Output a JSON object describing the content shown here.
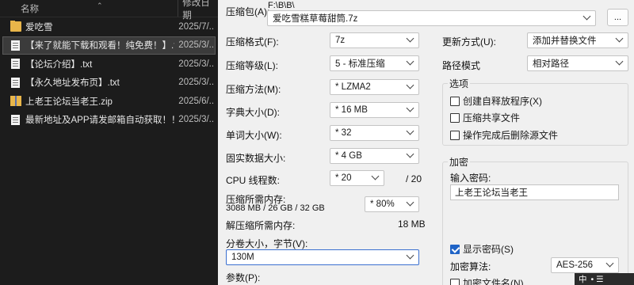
{
  "explorer": {
    "col_name": "名称",
    "col_date": "修改日期",
    "files": [
      {
        "name": "爱吃雪",
        "date": "2025/7/...",
        "type": "folder",
        "selected": false
      },
      {
        "name": "【来了就能下载和观看！纯免费！】.txt",
        "date": "2025/3/...",
        "type": "txt",
        "selected": true
      },
      {
        "name": "【论坛介绍】.txt",
        "date": "2025/3/...",
        "type": "txt",
        "selected": false
      },
      {
        "name": "【永久地址发布页】.txt",
        "date": "2025/3/...",
        "type": "txt",
        "selected": false
      },
      {
        "name": "上老王论坛当老王.zip",
        "date": "2025/6/...",
        "type": "zip",
        "selected": false
      },
      {
        "name": "最新地址及APP请发邮箱自动获取！！！...",
        "date": "2025/3/...",
        "type": "txt",
        "selected": false
      }
    ]
  },
  "dialog": {
    "archive_label": "压缩包(A):",
    "archive_path": "F:\\B\\B\\",
    "archive_name": "爱吃雪糕草莓甜筒.7z",
    "browse_label": "...",
    "format_label": "压缩格式(F):",
    "format_value": "7z",
    "level_label": "压缩等级(L):",
    "level_value": "5 - 标准压缩",
    "method_label": "压缩方法(M):",
    "method_value": "* LZMA2",
    "dict_label": "字典大小(D):",
    "dict_value": "* 16 MB",
    "word_label": "单词大小(W):",
    "word_value": "* 32",
    "solid_label": "固实数据大小:",
    "solid_value": "* 4 GB",
    "threads_label": "CPU 线程数:",
    "threads_value": "* 20",
    "threads_max": "/ 20",
    "mem_comp_label": "压缩所需内存:",
    "mem_comp_value": "3088 MB / 26 GB / 32 GB",
    "mem_percent": "* 80%",
    "mem_decomp_label": "解压缩所需内存:",
    "mem_decomp_value": "18 MB",
    "volume_label": "分卷大小，字节(V):",
    "volume_value": "130M",
    "params_label": "参数(P):",
    "update_label": "更新方式(U):",
    "update_value": "添加并替换文件",
    "path_label": "路径模式",
    "path_value": "相对路径",
    "options_title": "选项",
    "opt_sfx": "创建自释放程序(X)",
    "opt_shared": "压缩共享文件",
    "opt_delete": "操作完成后删除源文件",
    "encrypt_title": "加密",
    "password_label": "输入密码:",
    "password_value": "上老王论坛当老王",
    "show_pwd": "显示密码(S)",
    "method_enc_label": "加密算法:",
    "method_enc_value": "AES-256",
    "encrypt_names": "加密文件名(N)"
  },
  "taskbar": {
    "ime": "中",
    "extra": "• ☰"
  }
}
